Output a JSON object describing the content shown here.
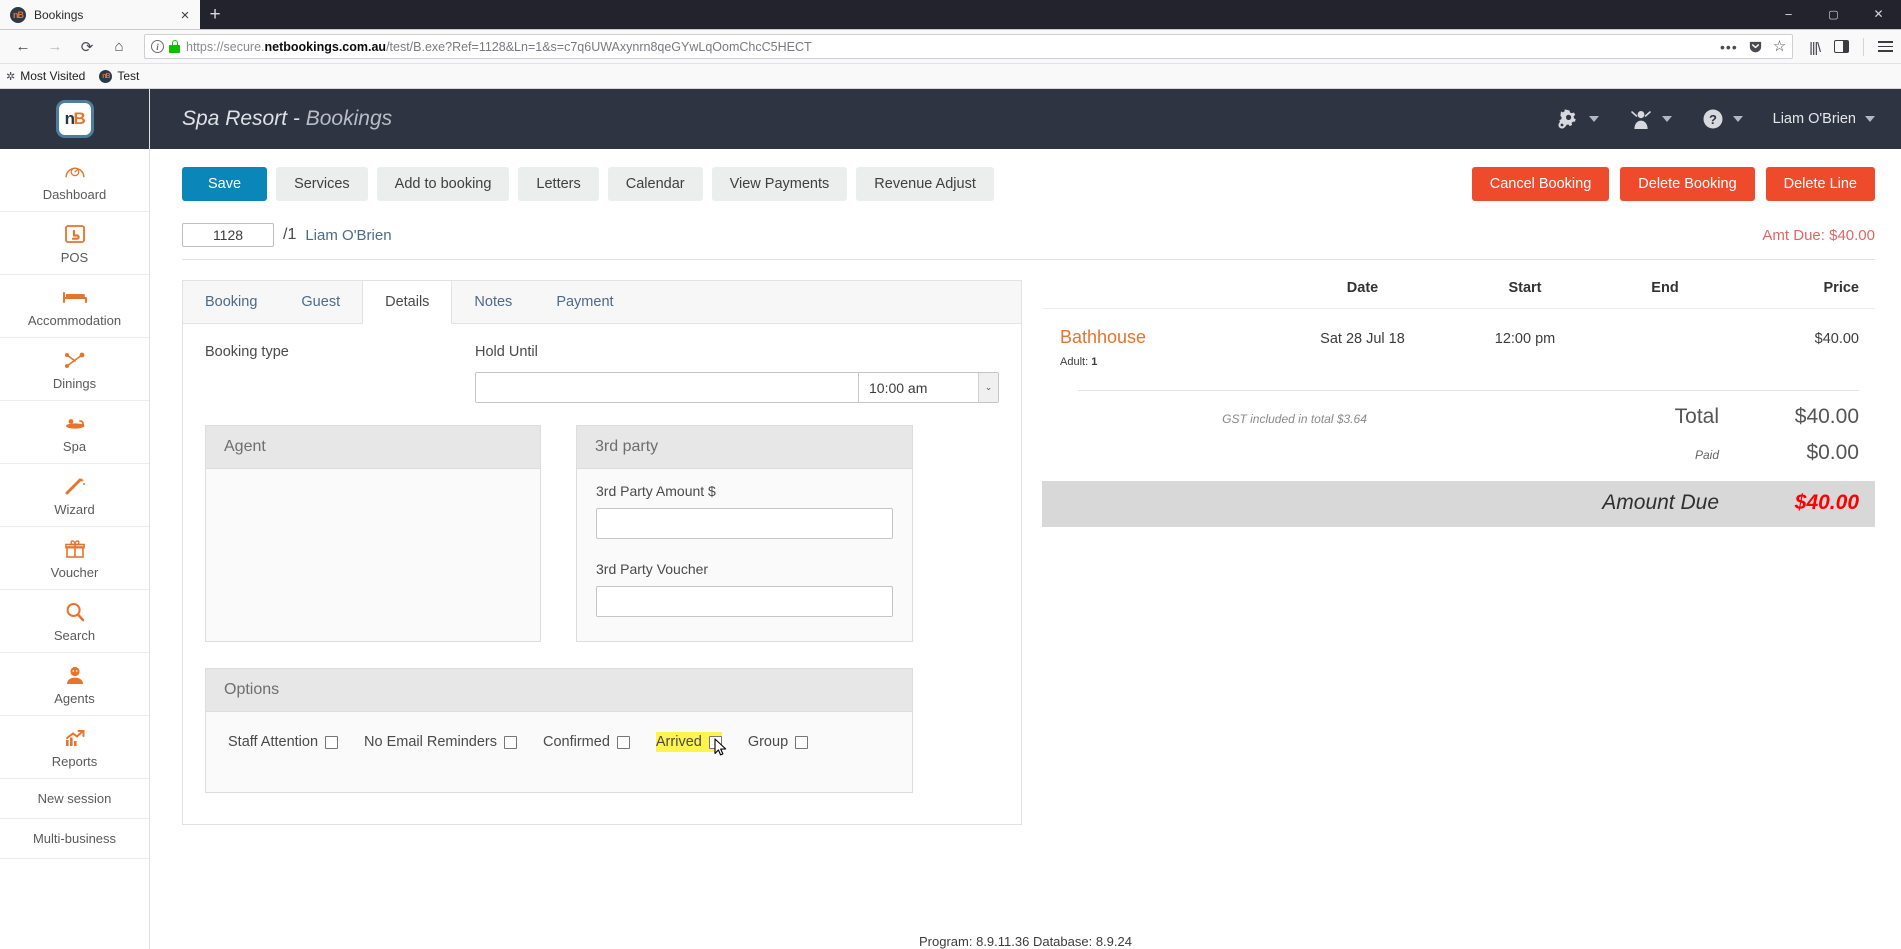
{
  "browser": {
    "tab": {
      "title": "Bookings",
      "favicon": "nb-favicon",
      "close": "×"
    },
    "new_tab": "+",
    "nav": {
      "back": "←",
      "forward": "→",
      "reload": "⟳",
      "home": "⌂"
    },
    "url": {
      "scheme": "https://secure.",
      "host": "netbookings.com.au",
      "path": "/test/B.exe?Ref=1128&Ln=1&s=c7q6UWAxynrn8qeGYwLqOomChcC5HECT",
      "full": "https://secure.netbookings.com.au/test/B.exe?Ref=1128&Ln=1&s=c7q6UWAxynrn8qeGYwLqOomChcC5HECT"
    },
    "url_actions": {
      "more": "•••",
      "pocket": "pocket-icon",
      "bookmark": "☆"
    },
    "bookmarks": [
      {
        "label": "Most Visited",
        "icon": "star-icon"
      },
      {
        "label": "Test",
        "icon": "nb-favicon"
      }
    ],
    "window_controls": {
      "minimize": "−",
      "maximize": "▢",
      "close": "✕"
    }
  },
  "sidebar": {
    "brand": {
      "n": "n",
      "b": "B"
    },
    "items": [
      {
        "label": "Dashboard",
        "icon": "dashboard-icon"
      },
      {
        "label": "POS",
        "icon": "pos-icon"
      },
      {
        "label": "Accommodation",
        "icon": "bed-icon"
      },
      {
        "label": "Dinings",
        "icon": "dining-icon"
      },
      {
        "label": "Spa",
        "icon": "spa-icon"
      },
      {
        "label": "Wizard",
        "icon": "wand-icon"
      },
      {
        "label": "Voucher",
        "icon": "gift-icon"
      },
      {
        "label": "Search",
        "icon": "search-icon"
      },
      {
        "label": "Agents",
        "icon": "agent-icon"
      },
      {
        "label": "Reports",
        "icon": "chart-icon"
      }
    ],
    "plain_items": [
      {
        "label": "New session"
      },
      {
        "label": "Multi-business"
      }
    ]
  },
  "header": {
    "title_main": "Spa Resort",
    "title_sep": " - ",
    "title_sub": "Bookings",
    "settings_icon": "gear-icon",
    "user_icon": "person-icon",
    "help_icon": "question-icon",
    "username": "Liam O'Brien"
  },
  "toolbar": {
    "save": "Save",
    "services": "Services",
    "add_to_booking": "Add to booking",
    "letters": "Letters",
    "calendar": "Calendar",
    "view_payments": "View Payments",
    "revenue_adjust": "Revenue Adjust",
    "cancel_booking": "Cancel Booking",
    "delete_booking": "Delete Booking",
    "delete_line": "Delete Line"
  },
  "reference": {
    "ref_number": "1128",
    "line": "/1",
    "guest_name": "Liam O'Brien",
    "amount_due": "Amt Due: $40.00"
  },
  "tabs": [
    {
      "label": "Booking",
      "active": false
    },
    {
      "label": "Guest",
      "active": false
    },
    {
      "label": "Details",
      "active": true
    },
    {
      "label": "Notes",
      "active": false
    },
    {
      "label": "Payment",
      "active": false
    }
  ],
  "details": {
    "booking_type_label": "Booking type",
    "hold_until_label": "Hold Until",
    "hold_until_value": "",
    "hold_until_placeholder": "",
    "hold_time_value": "10:00 am",
    "select_arrow": "⌄",
    "agent": {
      "title": "Agent"
    },
    "third_party": {
      "title": "3rd party",
      "amount_label": "3rd Party Amount $",
      "amount_value": "",
      "voucher_label": "3rd Party Voucher",
      "voucher_value": ""
    },
    "options": {
      "title": "Options",
      "items": [
        {
          "label": "Staff Attention",
          "checked": false,
          "highlighted": false
        },
        {
          "label": "No Email Reminders",
          "checked": false,
          "highlighted": false
        },
        {
          "label": "Confirmed",
          "checked": false,
          "highlighted": false
        },
        {
          "label": "Arrived",
          "checked": false,
          "highlighted": true
        },
        {
          "label": "Group",
          "checked": false,
          "highlighted": false
        }
      ]
    }
  },
  "summary": {
    "columns": {
      "item": "",
      "date": "Date",
      "start": "Start",
      "end": "End",
      "price": "Price"
    },
    "rows": [
      {
        "item": "Bathhouse",
        "date": "Sat 28 Jul 18",
        "start": "12:00 pm",
        "end": "",
        "price": "$40.00",
        "detail": "Adult: ",
        "detail_value": "1"
      }
    ],
    "gst_note": "GST included in total $3.64",
    "total_label": "Total",
    "total_value": "$40.00",
    "paid_label": "Paid",
    "paid_value": "$0.00",
    "due_label": "Amount Due",
    "due_value": "$40.00"
  },
  "footer": {
    "text": "Program: 8.9.11.36 Database: 8.9.24"
  },
  "colors": {
    "accent_orange": "#e8732b",
    "header_dark": "#2f3442",
    "primary_blue": "#0b86b8",
    "danger_red": "#ed4b2b",
    "due_red": "#ff0000",
    "highlight_yellow": "#fff34d"
  }
}
